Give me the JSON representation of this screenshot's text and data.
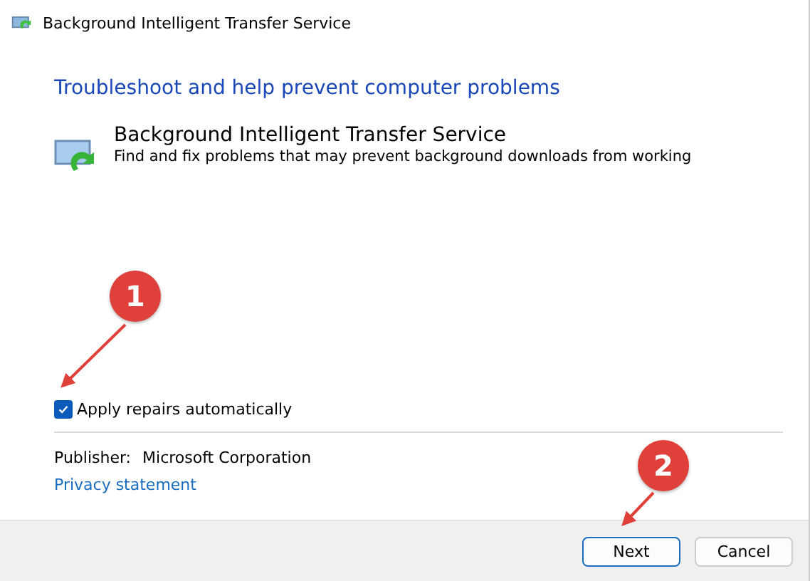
{
  "window": {
    "title": "Background Intelligent Transfer Service"
  },
  "heading": "Troubleshoot and help prevent computer problems",
  "troubleshooter": {
    "name": "Background Intelligent Transfer Service",
    "description": "Find and fix problems that may prevent background downloads from working"
  },
  "apply_repairs": {
    "label": "Apply repairs automatically",
    "checked": true
  },
  "publisher": {
    "label": "Publisher:",
    "value": "Microsoft Corporation"
  },
  "privacy_link": "Privacy statement",
  "buttons": [
    {
      "label": "Next",
      "default": true
    },
    {
      "label": "Cancel",
      "default": false
    }
  ],
  "annotations": [
    {
      "number": "1"
    },
    {
      "number": "2"
    }
  ]
}
